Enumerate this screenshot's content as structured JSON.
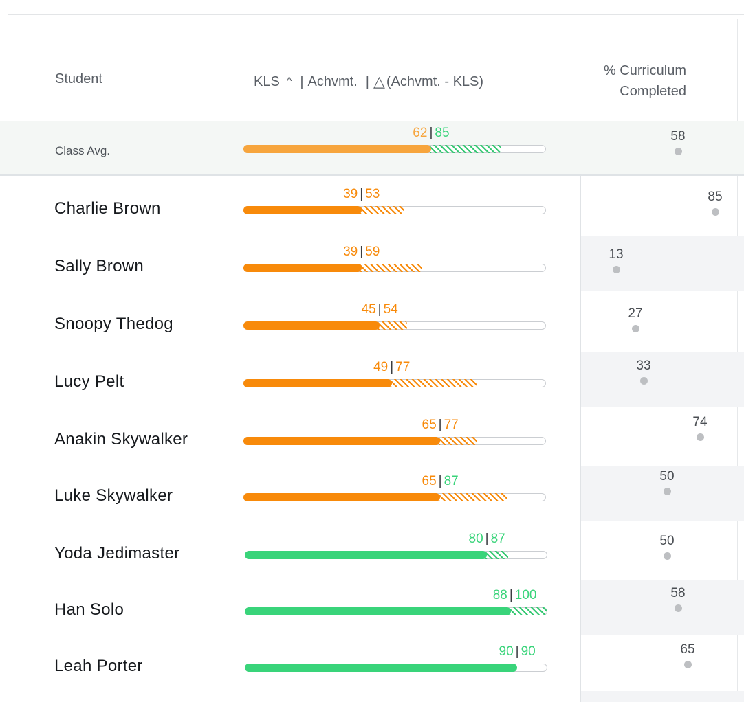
{
  "header": {
    "student": "Student",
    "kls": "KLS",
    "sort_caret": "^",
    "achvmt": "Achvmt.",
    "delta_symbol": "△",
    "delta_label": "(Achvmt. - KLS)",
    "curriculum_line1": "% Curriculum",
    "curriculum_line2": "Completed"
  },
  "class_avg": {
    "label": "Class Avg.",
    "kls": 62,
    "achvmt": 85,
    "curriculum": 58,
    "color": "#f7a53d"
  },
  "students": [
    {
      "name": "Charlie Brown",
      "kls": 39,
      "achvmt": 53,
      "curriculum": 85,
      "level": "orange"
    },
    {
      "name": "Sally Brown",
      "kls": 39,
      "achvmt": 59,
      "curriculum": 13,
      "level": "orange"
    },
    {
      "name": "Snoopy Thedog",
      "kls": 45,
      "achvmt": 54,
      "curriculum": 27,
      "level": "orange"
    },
    {
      "name": "Lucy Pelt",
      "kls": 49,
      "achvmt": 77,
      "curriculum": 33,
      "level": "orange"
    },
    {
      "name": "Anakin Skywalker",
      "kls": 65,
      "achvmt": 77,
      "curriculum": 74,
      "level": "orange"
    },
    {
      "name": "Luke Skywalker",
      "kls": 65,
      "achvmt": 87,
      "curriculum": 50,
      "level": "orange"
    },
    {
      "name": "Yoda Jedimaster",
      "kls": 80,
      "achvmt": 87,
      "curriculum": 50,
      "level": "green"
    },
    {
      "name": "Han Solo",
      "kls": 88,
      "achvmt": 100,
      "curriculum": 58,
      "level": "green"
    },
    {
      "name": "Leah Porter",
      "kls": 90,
      "achvmt": 90,
      "curriculum": 65,
      "level": "green"
    }
  ],
  "colors": {
    "orange": "#f88a0a",
    "green": "#39d47a",
    "hatch_green": "#35c872"
  }
}
